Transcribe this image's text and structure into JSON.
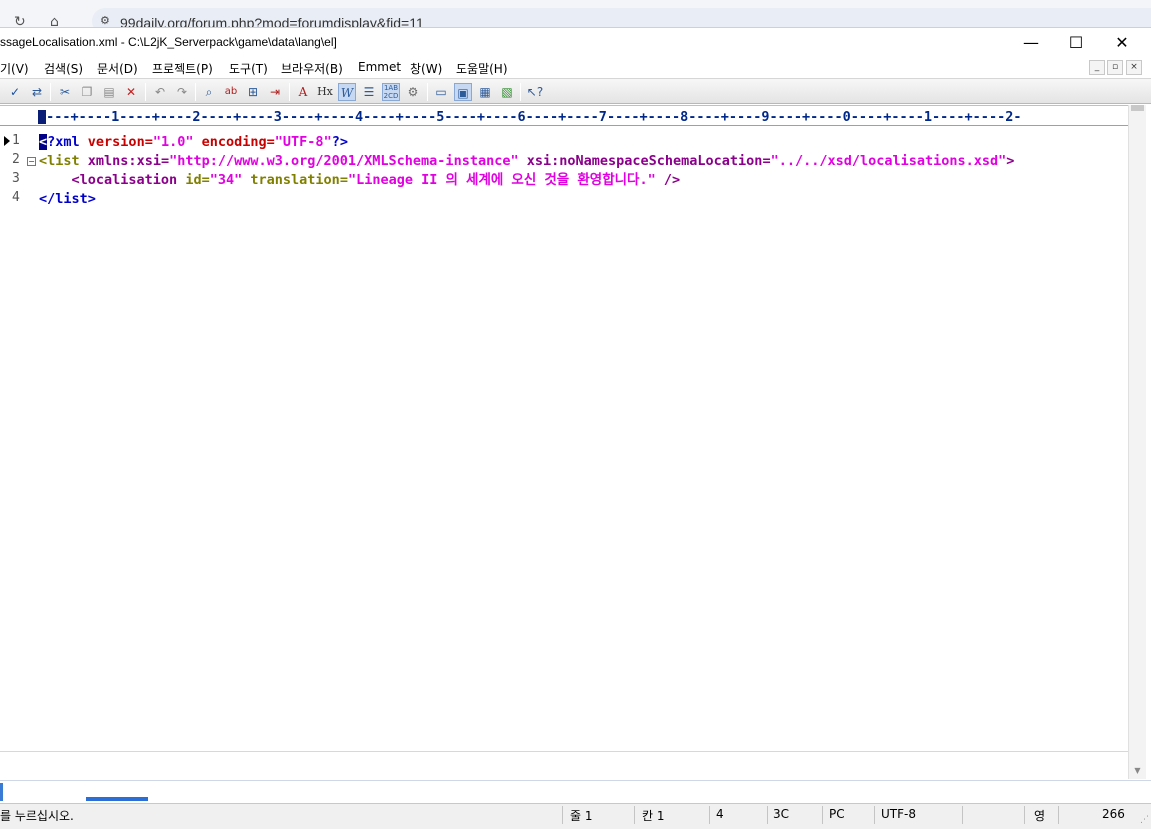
{
  "browser": {
    "url": "99daily.org/forum.php?mod=forumdisplay&fid=11"
  },
  "window": {
    "title": "ssageLocalisation.xml - C:\\L2jK_Serverpack\\game\\data\\lang\\el]",
    "controls": {
      "minimize": "—",
      "maximize": "☐",
      "close": "✕"
    }
  },
  "menu": {
    "items": [
      "기(V)",
      "검색(S)",
      "문서(D)",
      "프로젝트(P)",
      "도구(T)",
      "브라우저(B)",
      "Emmet",
      "창(W)",
      "도움말(H)"
    ]
  },
  "mdi": {
    "minimize": "_",
    "restore": "▫",
    "close": "×"
  },
  "toolbar": {
    "icons": [
      "spellcheck-icon",
      "toggle-icon",
      "cut-icon",
      "copy-icon",
      "paste-icon",
      "delete-icon",
      "undo-icon",
      "redo-icon",
      "find-icon",
      "replace-icon",
      "find-in-files-icon",
      "goto-icon",
      "font-icon",
      "heading-icon",
      "wrap-icon",
      "indent-icon",
      "sort-icon",
      "settings-icon",
      "view1-icon",
      "view2-icon",
      "view3-icon",
      "view4-icon",
      "context-help-icon"
    ]
  },
  "ruler": {
    "text": "----+----1----+----2----+----3----+----4----+----5----+----6----+----7----+----8----+----9----+----0----+----1----+----2-"
  },
  "editor": {
    "line_numbers": [
      "1",
      "2",
      "3",
      "4"
    ],
    "lines": [
      {
        "lt": "<",
        "pi": "?xml",
        "sp1": " ",
        "a1": "version",
        "eq1": "=",
        "v1": "\"1.0\"",
        "sp2": " ",
        "a2": "encoding",
        "eq2": "=",
        "v2": "\"UTF-8\"",
        "end": "?>"
      },
      {
        "lt": "<",
        "tag": "list",
        "sp1": " ",
        "a1": "xmlns:xsi",
        "eq1": "=",
        "v1": "\"http://www.w3.org/2001/XMLSchema-instance\"",
        "sp2": " ",
        "a2": "xsi:noNamespaceSchemaLocation",
        "eq2": "=",
        "v2": "\"../../xsd/localisations.xsd\"",
        "end": ">"
      },
      {
        "indent": "    ",
        "lt": "<",
        "tag": "localisation",
        "sp1": " ",
        "a1": "id",
        "eq1": "=",
        "v1": "\"34\"",
        "sp2": " ",
        "a2": "translation",
        "eq2": "=",
        "v2": "\"Lineage II 의 세계에 오신 것을 환영합니다.\"",
        "end": " />"
      },
      {
        "lt": "</",
        "tag": "list",
        "end": ">"
      }
    ]
  },
  "command_line": {
    "text": ""
  },
  "status": {
    "message": "를 누르십시오.",
    "line": "줄 1",
    "col": "칸 1",
    "lines_total": "4",
    "char_code": "3C",
    "platform": "PC",
    "encoding": "UTF-8",
    "ime": "영",
    "size": "266"
  }
}
